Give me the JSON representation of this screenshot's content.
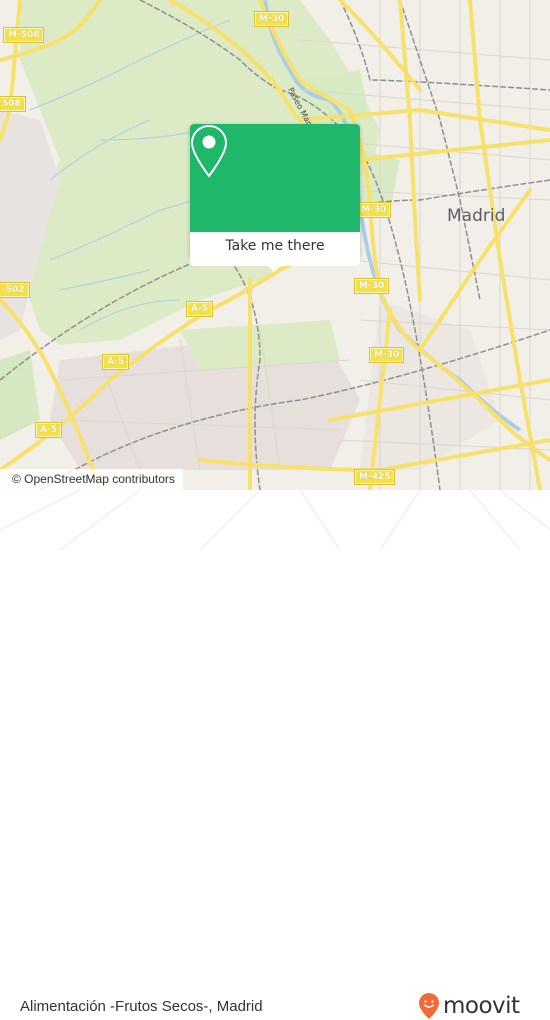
{
  "map": {
    "city_label": "Madrid",
    "street_label": "Paseo Manzanares",
    "road_labels": [
      {
        "id": "m508-top",
        "text": "M-508"
      },
      {
        "id": "m508-left",
        "text": "508"
      },
      {
        "id": "m30-top",
        "text": "M-30"
      },
      {
        "id": "m30-mid",
        "text": "M-30"
      },
      {
        "id": "m502",
        "text": "-502"
      },
      {
        "id": "a5-1",
        "text": "A-5"
      },
      {
        "id": "a5-2",
        "text": "A-5"
      },
      {
        "id": "a5-3",
        "text": "A-5"
      },
      {
        "id": "m30-right",
        "text": "M-30"
      },
      {
        "id": "m30-lower",
        "text": "M-30"
      },
      {
        "id": "m425",
        "text": "M-425"
      }
    ],
    "attribution": "© OpenStreetMap contributors"
  },
  "popup": {
    "icon": "location-pin-icon",
    "action_label": "Take me there",
    "accent_color": "#1fb86a"
  },
  "footer": {
    "place_name": "Alimentación -Frutos Secos-, Madrid",
    "logo_text": "moovit",
    "logo_color": "#f26a36"
  }
}
